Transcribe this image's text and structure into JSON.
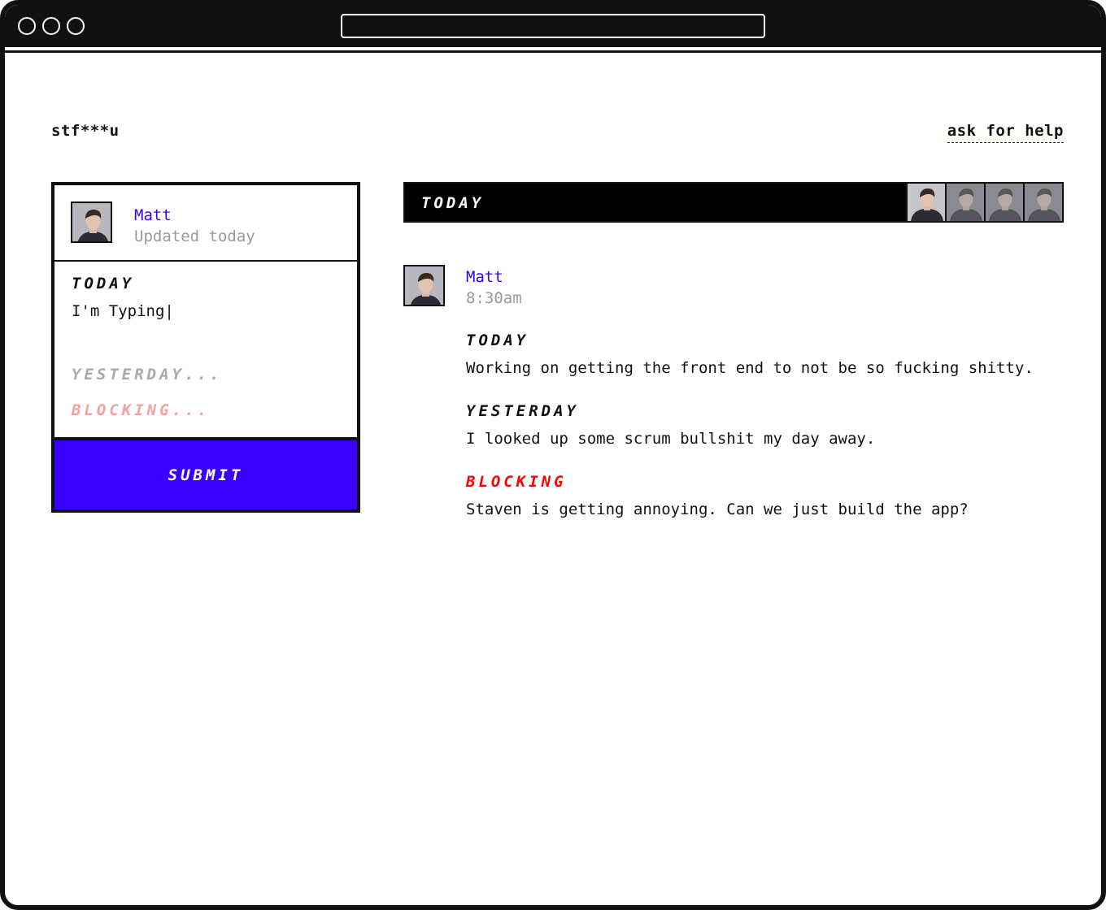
{
  "app": {
    "brand": "stf***u",
    "help_link": "ask for help"
  },
  "composer": {
    "user_name": "Matt",
    "user_status": "Updated today",
    "today_label": "TODAY",
    "today_value": "I'm Typing|",
    "yesterday_placeholder": "YESTERDAY...",
    "blocking_placeholder": "BLOCKING...",
    "submit_label": "SUBMIT"
  },
  "feed": {
    "header_label": "TODAY",
    "team_avatars": [
      "avatar-matt",
      "avatar-teammate",
      "avatar-teammate",
      "avatar-teammate"
    ],
    "post": {
      "user_name": "Matt",
      "time": "8:30am",
      "today_label": "TODAY",
      "today_text": "Working on getting the front end to not be so fucking shitty.",
      "yesterday_label": "YESTERDAY",
      "yesterday_text": "I looked up some scrum bullshit my day away.",
      "blocking_label": "BLOCKING",
      "blocking_text": "Staven is getting annoying. Can we just build the app?"
    }
  },
  "colors": {
    "accent": "#3a00ff",
    "blocking": "#ff0000",
    "muted": "#9a9a9a",
    "ink": "#111111"
  }
}
